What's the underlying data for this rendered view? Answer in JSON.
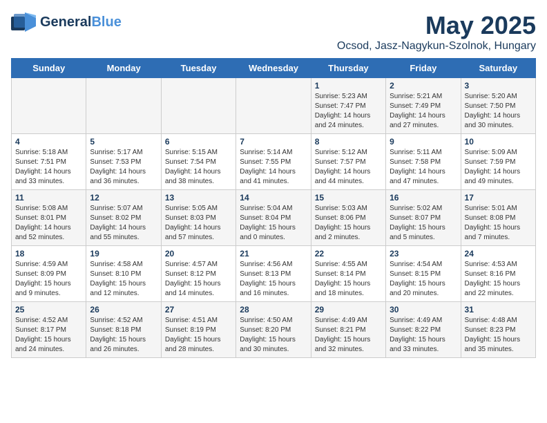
{
  "header": {
    "logo_main": "General",
    "logo_accent": "Blue",
    "month_title": "May 2025",
    "subtitle": "Ocsod, Jasz-Nagykun-Szolnok, Hungary"
  },
  "days_of_week": [
    "Sunday",
    "Monday",
    "Tuesday",
    "Wednesday",
    "Thursday",
    "Friday",
    "Saturday"
  ],
  "weeks": [
    [
      {
        "day": "",
        "detail": ""
      },
      {
        "day": "",
        "detail": ""
      },
      {
        "day": "",
        "detail": ""
      },
      {
        "day": "",
        "detail": ""
      },
      {
        "day": "1",
        "detail": "Sunrise: 5:23 AM\nSunset: 7:47 PM\nDaylight: 14 hours and 24 minutes."
      },
      {
        "day": "2",
        "detail": "Sunrise: 5:21 AM\nSunset: 7:49 PM\nDaylight: 14 hours and 27 minutes."
      },
      {
        "day": "3",
        "detail": "Sunrise: 5:20 AM\nSunset: 7:50 PM\nDaylight: 14 hours and 30 minutes."
      }
    ],
    [
      {
        "day": "4",
        "detail": "Sunrise: 5:18 AM\nSunset: 7:51 PM\nDaylight: 14 hours and 33 minutes."
      },
      {
        "day": "5",
        "detail": "Sunrise: 5:17 AM\nSunset: 7:53 PM\nDaylight: 14 hours and 36 minutes."
      },
      {
        "day": "6",
        "detail": "Sunrise: 5:15 AM\nSunset: 7:54 PM\nDaylight: 14 hours and 38 minutes."
      },
      {
        "day": "7",
        "detail": "Sunrise: 5:14 AM\nSunset: 7:55 PM\nDaylight: 14 hours and 41 minutes."
      },
      {
        "day": "8",
        "detail": "Sunrise: 5:12 AM\nSunset: 7:57 PM\nDaylight: 14 hours and 44 minutes."
      },
      {
        "day": "9",
        "detail": "Sunrise: 5:11 AM\nSunset: 7:58 PM\nDaylight: 14 hours and 47 minutes."
      },
      {
        "day": "10",
        "detail": "Sunrise: 5:09 AM\nSunset: 7:59 PM\nDaylight: 14 hours and 49 minutes."
      }
    ],
    [
      {
        "day": "11",
        "detail": "Sunrise: 5:08 AM\nSunset: 8:01 PM\nDaylight: 14 hours and 52 minutes."
      },
      {
        "day": "12",
        "detail": "Sunrise: 5:07 AM\nSunset: 8:02 PM\nDaylight: 14 hours and 55 minutes."
      },
      {
        "day": "13",
        "detail": "Sunrise: 5:05 AM\nSunset: 8:03 PM\nDaylight: 14 hours and 57 minutes."
      },
      {
        "day": "14",
        "detail": "Sunrise: 5:04 AM\nSunset: 8:04 PM\nDaylight: 15 hours and 0 minutes."
      },
      {
        "day": "15",
        "detail": "Sunrise: 5:03 AM\nSunset: 8:06 PM\nDaylight: 15 hours and 2 minutes."
      },
      {
        "day": "16",
        "detail": "Sunrise: 5:02 AM\nSunset: 8:07 PM\nDaylight: 15 hours and 5 minutes."
      },
      {
        "day": "17",
        "detail": "Sunrise: 5:01 AM\nSunset: 8:08 PM\nDaylight: 15 hours and 7 minutes."
      }
    ],
    [
      {
        "day": "18",
        "detail": "Sunrise: 4:59 AM\nSunset: 8:09 PM\nDaylight: 15 hours and 9 minutes."
      },
      {
        "day": "19",
        "detail": "Sunrise: 4:58 AM\nSunset: 8:10 PM\nDaylight: 15 hours and 12 minutes."
      },
      {
        "day": "20",
        "detail": "Sunrise: 4:57 AM\nSunset: 8:12 PM\nDaylight: 15 hours and 14 minutes."
      },
      {
        "day": "21",
        "detail": "Sunrise: 4:56 AM\nSunset: 8:13 PM\nDaylight: 15 hours and 16 minutes."
      },
      {
        "day": "22",
        "detail": "Sunrise: 4:55 AM\nSunset: 8:14 PM\nDaylight: 15 hours and 18 minutes."
      },
      {
        "day": "23",
        "detail": "Sunrise: 4:54 AM\nSunset: 8:15 PM\nDaylight: 15 hours and 20 minutes."
      },
      {
        "day": "24",
        "detail": "Sunrise: 4:53 AM\nSunset: 8:16 PM\nDaylight: 15 hours and 22 minutes."
      }
    ],
    [
      {
        "day": "25",
        "detail": "Sunrise: 4:52 AM\nSunset: 8:17 PM\nDaylight: 15 hours and 24 minutes."
      },
      {
        "day": "26",
        "detail": "Sunrise: 4:52 AM\nSunset: 8:18 PM\nDaylight: 15 hours and 26 minutes."
      },
      {
        "day": "27",
        "detail": "Sunrise: 4:51 AM\nSunset: 8:19 PM\nDaylight: 15 hours and 28 minutes."
      },
      {
        "day": "28",
        "detail": "Sunrise: 4:50 AM\nSunset: 8:20 PM\nDaylight: 15 hours and 30 minutes."
      },
      {
        "day": "29",
        "detail": "Sunrise: 4:49 AM\nSunset: 8:21 PM\nDaylight: 15 hours and 32 minutes."
      },
      {
        "day": "30",
        "detail": "Sunrise: 4:49 AM\nSunset: 8:22 PM\nDaylight: 15 hours and 33 minutes."
      },
      {
        "day": "31",
        "detail": "Sunrise: 4:48 AM\nSunset: 8:23 PM\nDaylight: 15 hours and 35 minutes."
      }
    ]
  ]
}
